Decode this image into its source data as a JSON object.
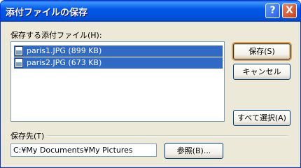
{
  "window": {
    "title": "添付ファイルの保存",
    "help_label": "?",
    "close_label": "X"
  },
  "list_label": "保存する添付ファイル(H):",
  "files": [
    {
      "name": "paris1.JPG (899 KB)"
    },
    {
      "name": "paris2.JPG (673 KB)"
    }
  ],
  "buttons": {
    "save": "保存(S)",
    "cancel": "キャンセル",
    "select_all": "すべて選択(A)",
    "browse": "参照(B)..."
  },
  "destination": {
    "label": "保存先(T)",
    "value": "C:¥My Documents¥My Pictures"
  }
}
